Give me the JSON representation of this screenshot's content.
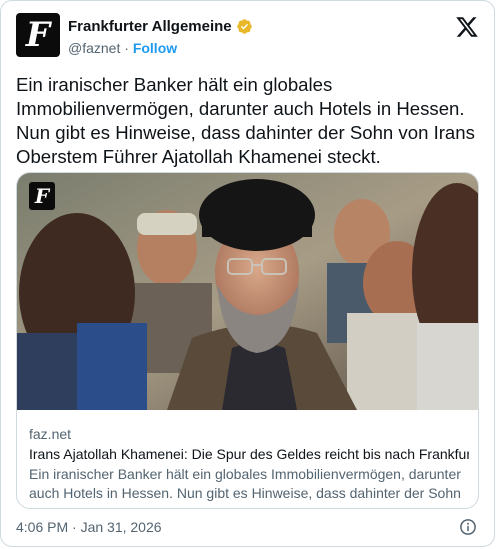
{
  "account": {
    "name": "Frankfurter Allgemeine",
    "handle": "@faznet",
    "separator": "·",
    "follow_label": "Follow",
    "avatar_glyph": "F"
  },
  "tweet": {
    "text": "Ein iranischer Banker hält ein globales Immobilienvermögen, darunter auch Hotels in Hessen. Nun gibt es Hinweise, dass dahinter der Sohn von Irans Oberstem Führer Ajatollah Khamenei steckt."
  },
  "link_card": {
    "domain": "faz.net",
    "title": "Irans Ajatollah Khamenei: Die Spur des Geldes reicht bis nach Frankfurt",
    "description": "Ein iranischer Banker hält ein globales Immobilienvermögen, darunter auch Hotels in Hessen. Nun gibt es Hinweise, dass dahinter der Sohn vo..."
  },
  "footer": {
    "timestamp": "4:06 PM · Jan 31, 2026"
  },
  "colors": {
    "accent": "#1d9bf0",
    "verified_gold": "#e8b829",
    "secondary_text": "#536471",
    "border": "#cfd9de"
  },
  "icons": {
    "brand": "x-logo-icon",
    "verified": "verified-badge-icon",
    "info": "info-icon"
  }
}
